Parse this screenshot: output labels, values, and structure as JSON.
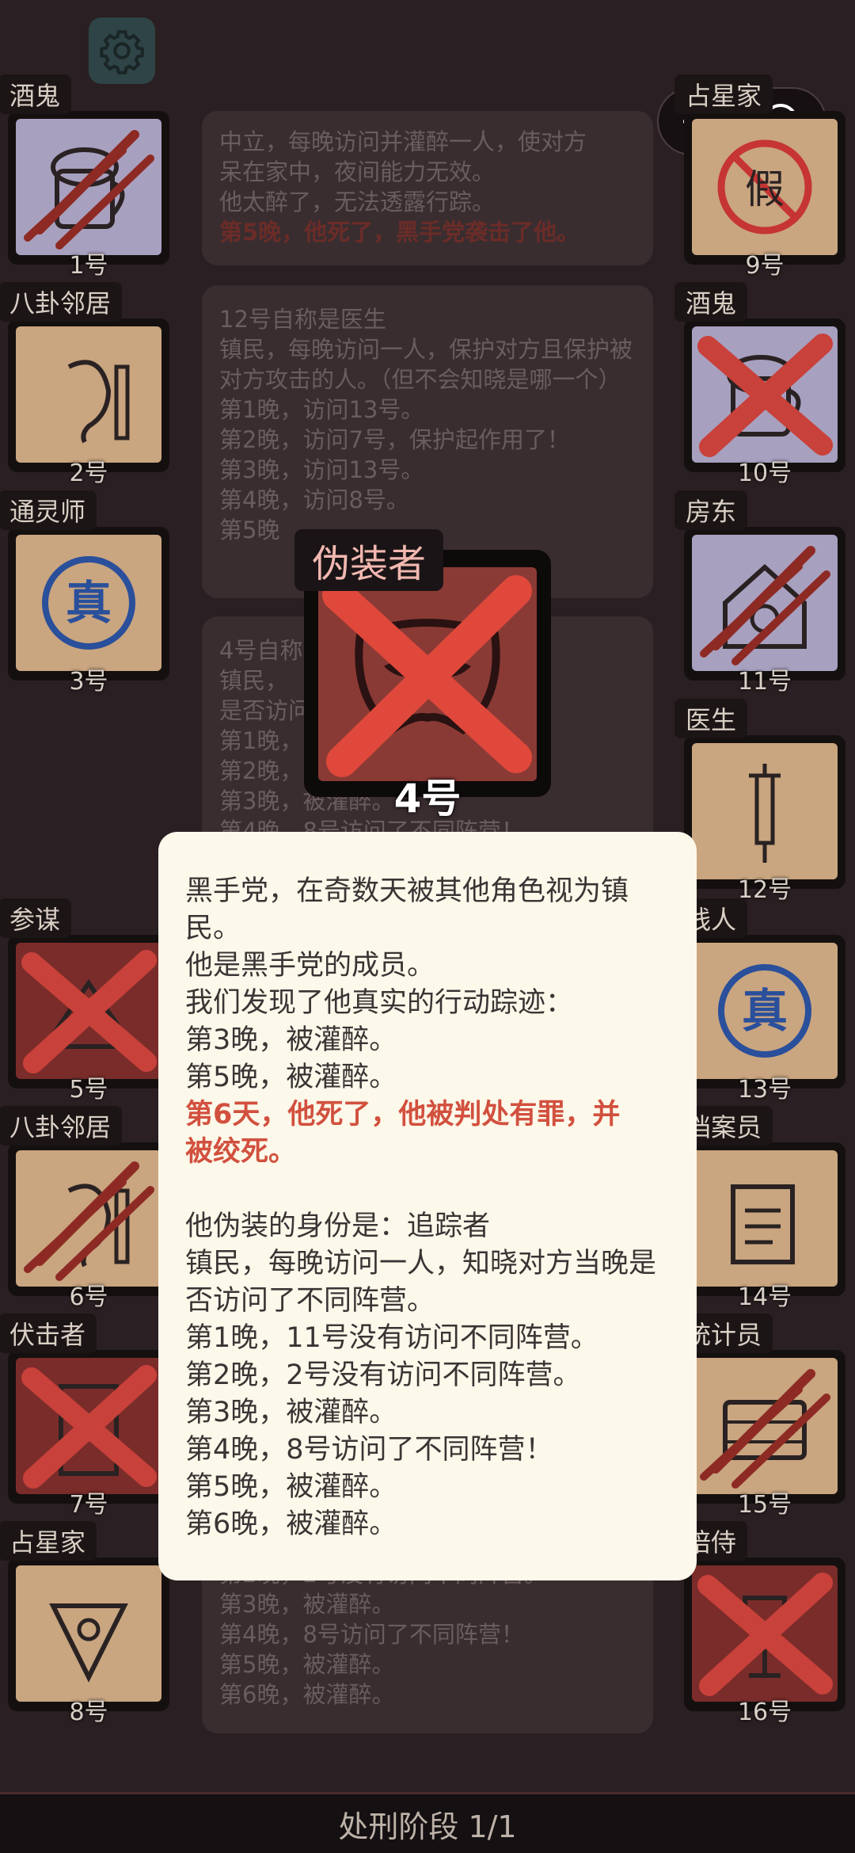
{
  "top": {
    "settings_icon": "gear-icon",
    "menu_icon": "more-dots-icon",
    "close_icon": "target-icon"
  },
  "left_cards": [
    {
      "role": "酒鬼",
      "num": "1号",
      "face": "lilac",
      "mark": "claw",
      "icon": "beer-icon"
    },
    {
      "role": "八卦邻居",
      "num": "2号",
      "face": "tan",
      "mark": "",
      "icon": "ear-icon"
    },
    {
      "role": "通灵师",
      "num": "3号",
      "face": "tan",
      "mark": "",
      "icon": "true-stamp-icon"
    },
    {
      "role": "参谋",
      "num": "5号",
      "face": "red",
      "mark": "cross",
      "icon": "tent-icon"
    },
    {
      "role": "八卦邻居",
      "num": "6号",
      "face": "tan",
      "mark": "claw",
      "icon": "ear-icon"
    },
    {
      "role": "伏击者",
      "num": "7号",
      "face": "red",
      "mark": "cross",
      "icon": "door-icon"
    },
    {
      "role": "占星家",
      "num": "8号",
      "face": "tan",
      "mark": "",
      "icon": "sextant-icon"
    }
  ],
  "right_cards": [
    {
      "role": "占星家",
      "num": "9号",
      "face": "tan",
      "mark": "",
      "icon": "no-fake-icon"
    },
    {
      "role": "酒鬼",
      "num": "10号",
      "face": "lilac",
      "mark": "cross",
      "icon": "beer-icon"
    },
    {
      "role": "房东",
      "num": "11号",
      "face": "lilac",
      "mark": "claw",
      "icon": "house-icon"
    },
    {
      "role": "医生",
      "num": "12号",
      "face": "tan",
      "mark": "",
      "icon": "syringe-icon"
    },
    {
      "role": "线人",
      "num": "13号",
      "face": "tan",
      "mark": "",
      "icon": "true-stamp-icon"
    },
    {
      "role": "档案员",
      "num": "14号",
      "face": "tan",
      "mark": "",
      "icon": "documents-icon"
    },
    {
      "role": "统计员",
      "num": "15号",
      "face": "tan",
      "mark": "claw",
      "icon": "abacus-icon"
    },
    {
      "role": "陪侍",
      "num": "16号",
      "face": "red",
      "mark": "cross",
      "icon": "wineglass-icon"
    }
  ],
  "log1": {
    "lines": [
      "中立，每晚访问并灌醉一人，使对方",
      "呆在家中，夜间能力无效。",
      "他太醉了，无法透露行踪。"
    ],
    "red": "第5晚，他死了，黑手党袭击了他。"
  },
  "log2": {
    "lines": [
      "12号自称是医生",
      "镇民，每晚访问一人，保护对方且保护被对方攻击的人。（但不会知晓是哪一个）",
      "第1晚，访问13号。",
      "第2晚，访问7号，保护起作用了！",
      "第3晚，访问13号。",
      "第4晚，访问8号。",
      "第5晚"
    ]
  },
  "log3": {
    "lines": [
      "4号自称",
      "镇民，",
      "是否访问",
      "第1晚，",
      "第2晚，",
      "第3晚，被灌醉。",
      "第4晚，8号访问了不同阵营！"
    ]
  },
  "log4": {
    "lines": [
      "第2晚，2号没有访问不同阵营。",
      "第3晚，被灌醉。",
      "第4晚，8号访问了不同阵营！",
      "第5晚，被灌醉。",
      "第6晚，被灌醉。"
    ]
  },
  "center": {
    "role": "伪装者",
    "num": "4号",
    "icon": "mask-icon"
  },
  "popup": {
    "lines_a": [
      "黑手党，在奇数天被其他角色视为镇民。",
      "他是黑手党的成员。",
      "我们发现了他真实的行动踪迹：",
      "第3晚，被灌醉。",
      "第5晚，被灌醉。"
    ],
    "red": "第6天，他死了，他被判处有罪，并被绞死。",
    "lines_b": [
      "他伪装的身份是：追踪者",
      "镇民，每晚访问一人，知晓对方当晚是否访问了不同阵营。",
      "第1晚，11号没有访问不同阵营。",
      "第2晚，2号没有访问不同阵营。",
      "第3晚，被灌醉。",
      "第4晚，8号访问了不同阵营！",
      "第5晚，被灌醉。",
      "第6晚，被灌醉。"
    ]
  },
  "footer": {
    "label": "处刑阶段 1/1"
  },
  "colors": {
    "accent_red": "#d2503e",
    "panel": "#fcf8ea"
  }
}
